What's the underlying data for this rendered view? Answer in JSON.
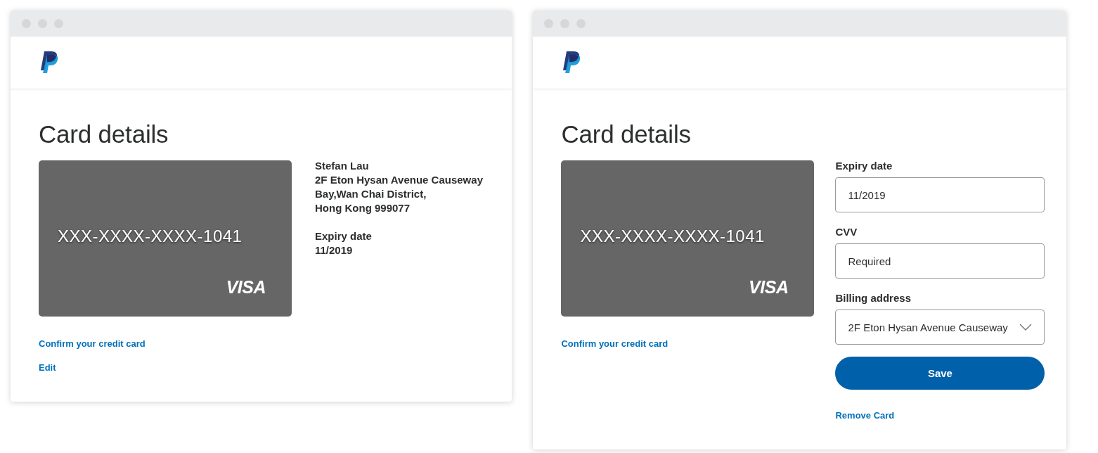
{
  "windows": [
    {
      "kind": "view",
      "heading": "Card details",
      "card": {
        "number": "XXX-XXXX-XXXX-1041",
        "brand": "VISA"
      },
      "details": {
        "name": "Stefan Lau",
        "address": [
          "2F Eton Hysan Avenue Causeway",
          "Bay,Wan Chai District,",
          "Hong Kong 999077"
        ],
        "expiry_label": "Expiry date",
        "expiry": "11/2019"
      },
      "links": [
        "Confirm your credit card",
        "Edit"
      ]
    },
    {
      "kind": "edit",
      "heading": "Card details",
      "card": {
        "number": "XXX-XXXX-XXXX-1041",
        "brand": "VISA"
      },
      "form": {
        "fields": [
          {
            "kind": "input",
            "label": "Expiry date",
            "value": "11/2019"
          },
          {
            "kind": "input",
            "label": "CVV",
            "placeholder": "Required"
          },
          {
            "kind": "select",
            "label": "Billing address",
            "value": "2F Eton Hysan Avenue Causeway"
          }
        ],
        "save_button": "Save",
        "remove_link": "Remove Card"
      },
      "links": [
        "Confirm your credit card"
      ]
    }
  ]
}
